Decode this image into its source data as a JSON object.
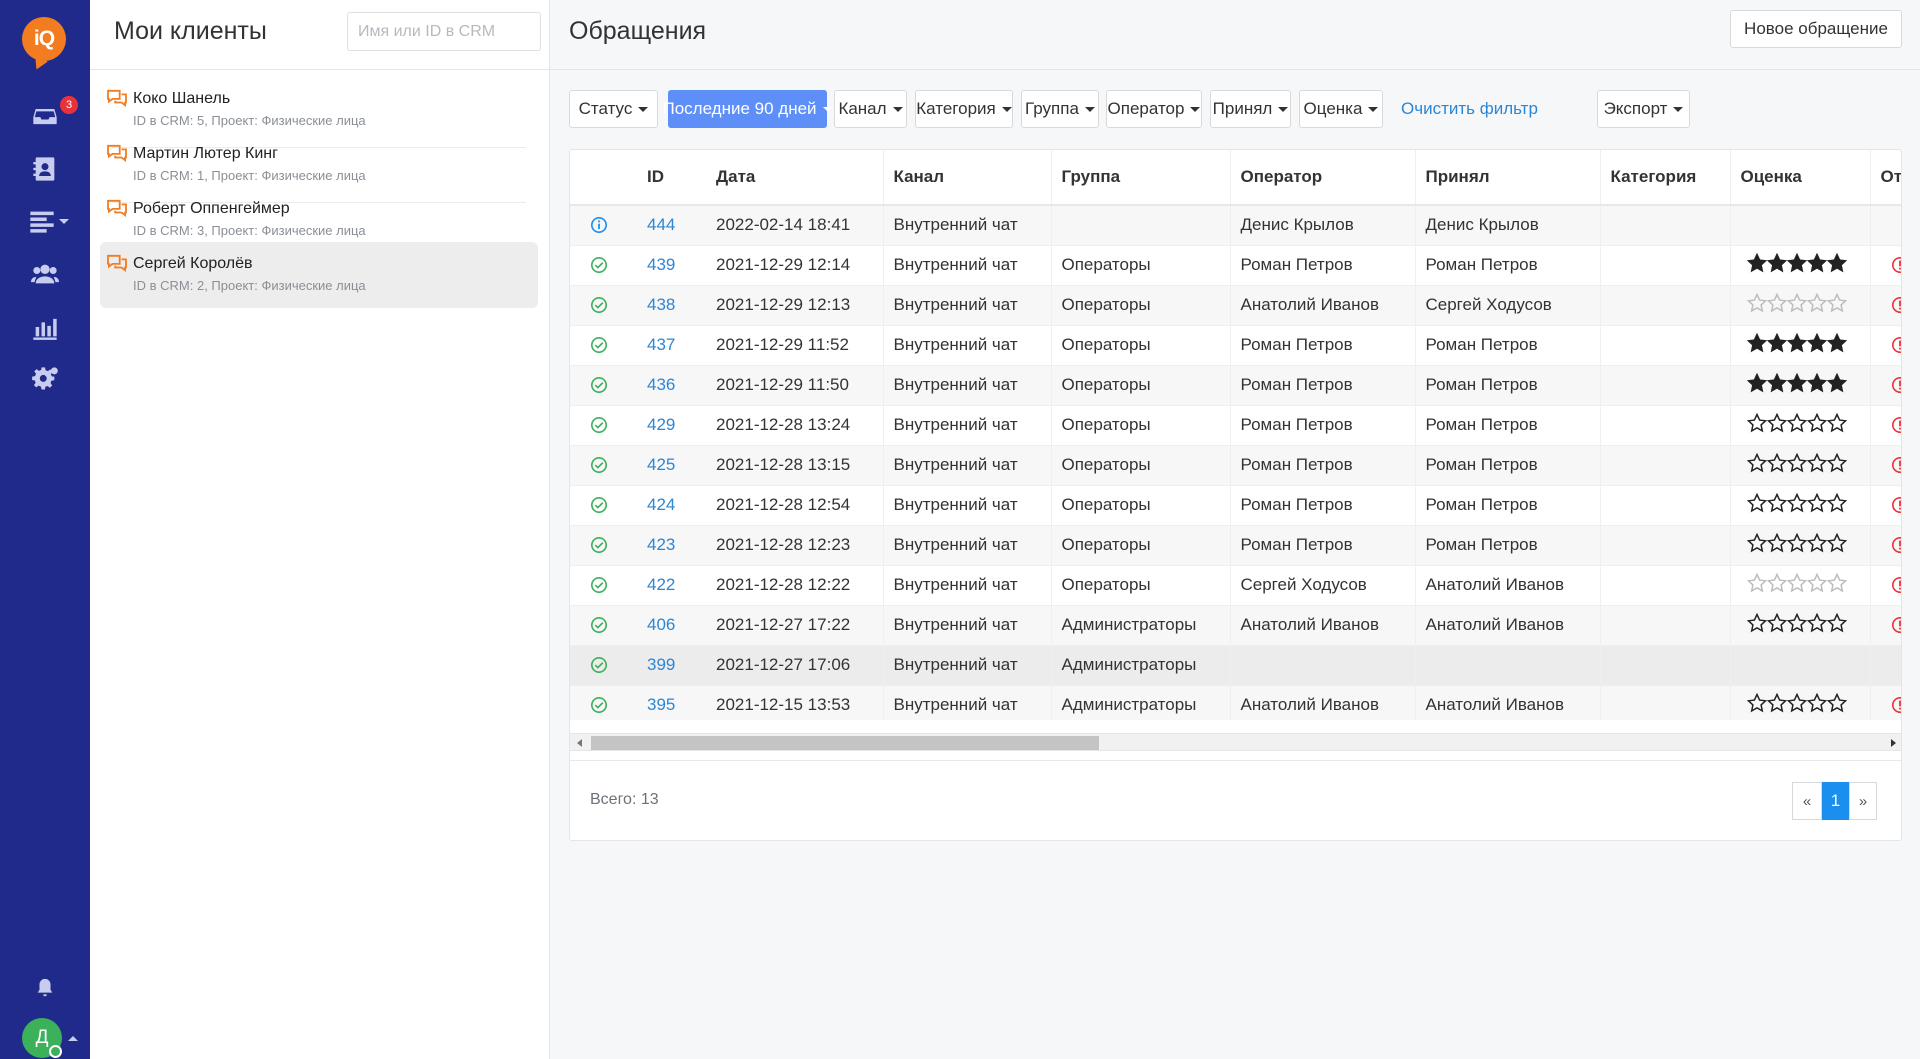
{
  "app": {
    "logo_text": "iQ",
    "inbox_badge": "3",
    "user_initial": "Д"
  },
  "colors": {
    "sidebar_bg": "#1f2a8a",
    "logo": "#f47c20",
    "primary_button": "#5e8ef7",
    "link": "#2c86d6",
    "status_ok": "#3bb15a",
    "status_info": "#1b8ff0",
    "alert": "#e8323a",
    "badge": "#e8323a"
  },
  "rail": {
    "icons": [
      "inbox-icon",
      "contacts-icon",
      "list-menu-icon",
      "users-icon",
      "stats-icon",
      "settings-icon",
      "bell-icon"
    ]
  },
  "clients": {
    "title": "Мои клиенты",
    "search_placeholder": "Имя или ID в CRM",
    "items": [
      {
        "name": "Коко Шанель",
        "sub": "ID в CRM: 5, Проект: Физические лица",
        "active": false
      },
      {
        "name": "Мартин Лютер Кинг",
        "sub": "ID в CRM: 1, Проект: Физические лица",
        "active": false
      },
      {
        "name": "Роберт Оппенгеймер",
        "sub": "ID в CRM: 3, Проект: Физические лица",
        "active": false
      },
      {
        "name": "Сергей Королёв",
        "sub": "ID в CRM: 2, Проект: Физические лица",
        "active": true
      }
    ]
  },
  "main": {
    "title": "Обращения",
    "new_button": "Новое обращение",
    "filters": {
      "status": "Статус",
      "period": "Последние 90 дней",
      "channel": "Канал",
      "category": "Категория",
      "group": "Группа",
      "operator": "Оператор",
      "accepted": "Принял",
      "rating": "Оценка",
      "clear": "Очистить фильтр",
      "export": "Экспорт"
    },
    "table": {
      "columns": [
        "ID",
        "Дата",
        "Канал",
        "Группа",
        "Оператор",
        "Принял",
        "Категория",
        "Оценка",
        "От"
      ],
      "rows": [
        {
          "status": "info",
          "id": "444",
          "date": "2022-02-14 18:41",
          "channel": "Внутренний чат",
          "group": "",
          "operator": "Денис Крылов",
          "accepted": "Денис Крылов",
          "category": "",
          "rating": "none",
          "alert": false
        },
        {
          "status": "ok",
          "id": "439",
          "date": "2021-12-29 12:14",
          "channel": "Внутренний чат",
          "group": "Операторы",
          "operator": "Роман Петров",
          "accepted": "Роман Петров",
          "category": "",
          "rating": "filled",
          "alert": true
        },
        {
          "status": "ok",
          "id": "438",
          "date": "2021-12-29 12:13",
          "channel": "Внутренний чат",
          "group": "Операторы",
          "operator": "Анатолий Иванов",
          "accepted": "Сергей Ходусов",
          "category": "",
          "rating": "faint",
          "alert": true
        },
        {
          "status": "ok",
          "id": "437",
          "date": "2021-12-29 11:52",
          "channel": "Внутренний чат",
          "group": "Операторы",
          "operator": "Роман Петров",
          "accepted": "Роман Петров",
          "category": "",
          "rating": "filled",
          "alert": true
        },
        {
          "status": "ok",
          "id": "436",
          "date": "2021-12-29 11:50",
          "channel": "Внутренний чат",
          "group": "Операторы",
          "operator": "Роман Петров",
          "accepted": "Роман Петров",
          "category": "",
          "rating": "filled",
          "alert": true
        },
        {
          "status": "ok",
          "id": "429",
          "date": "2021-12-28 13:24",
          "channel": "Внутренний чат",
          "group": "Операторы",
          "operator": "Роман Петров",
          "accepted": "Роман Петров",
          "category": "",
          "rating": "empty",
          "alert": true
        },
        {
          "status": "ok",
          "id": "425",
          "date": "2021-12-28 13:15",
          "channel": "Внутренний чат",
          "group": "Операторы",
          "operator": "Роман Петров",
          "accepted": "Роман Петров",
          "category": "",
          "rating": "empty",
          "alert": true
        },
        {
          "status": "ok",
          "id": "424",
          "date": "2021-12-28 12:54",
          "channel": "Внутренний чат",
          "group": "Операторы",
          "operator": "Роман Петров",
          "accepted": "Роман Петров",
          "category": "",
          "rating": "empty",
          "alert": true
        },
        {
          "status": "ok",
          "id": "423",
          "date": "2021-12-28 12:23",
          "channel": "Внутренний чат",
          "group": "Операторы",
          "operator": "Роман Петров",
          "accepted": "Роман Петров",
          "category": "",
          "rating": "empty",
          "alert": true
        },
        {
          "status": "ok",
          "id": "422",
          "date": "2021-12-28 12:22",
          "channel": "Внутренний чат",
          "group": "Операторы",
          "operator": "Сергей Ходусов",
          "accepted": "Анатолий Иванов",
          "category": "",
          "rating": "faint",
          "alert": true
        },
        {
          "status": "ok",
          "id": "406",
          "date": "2021-12-27 17:22",
          "channel": "Внутренний чат",
          "group": "Администраторы",
          "operator": "Анатолий Иванов",
          "accepted": "Анатолий Иванов",
          "category": "",
          "rating": "empty",
          "alert": true
        },
        {
          "status": "ok",
          "id": "399",
          "date": "2021-12-27 17:06",
          "channel": "Внутренний чат",
          "group": "Администраторы",
          "operator": "",
          "accepted": "",
          "category": "",
          "rating": "none",
          "alert": false,
          "highlight": true
        },
        {
          "status": "ok",
          "id": "395",
          "date": "2021-12-15 13:53",
          "channel": "Внутренний чат",
          "group": "Администраторы",
          "operator": "Анатолий Иванов",
          "accepted": "Анатолий Иванов",
          "category": "",
          "rating": "empty",
          "alert": true
        }
      ]
    },
    "total_label": "Всего: 13",
    "pagination": {
      "prev": "«",
      "current": "1",
      "next": "»"
    }
  }
}
